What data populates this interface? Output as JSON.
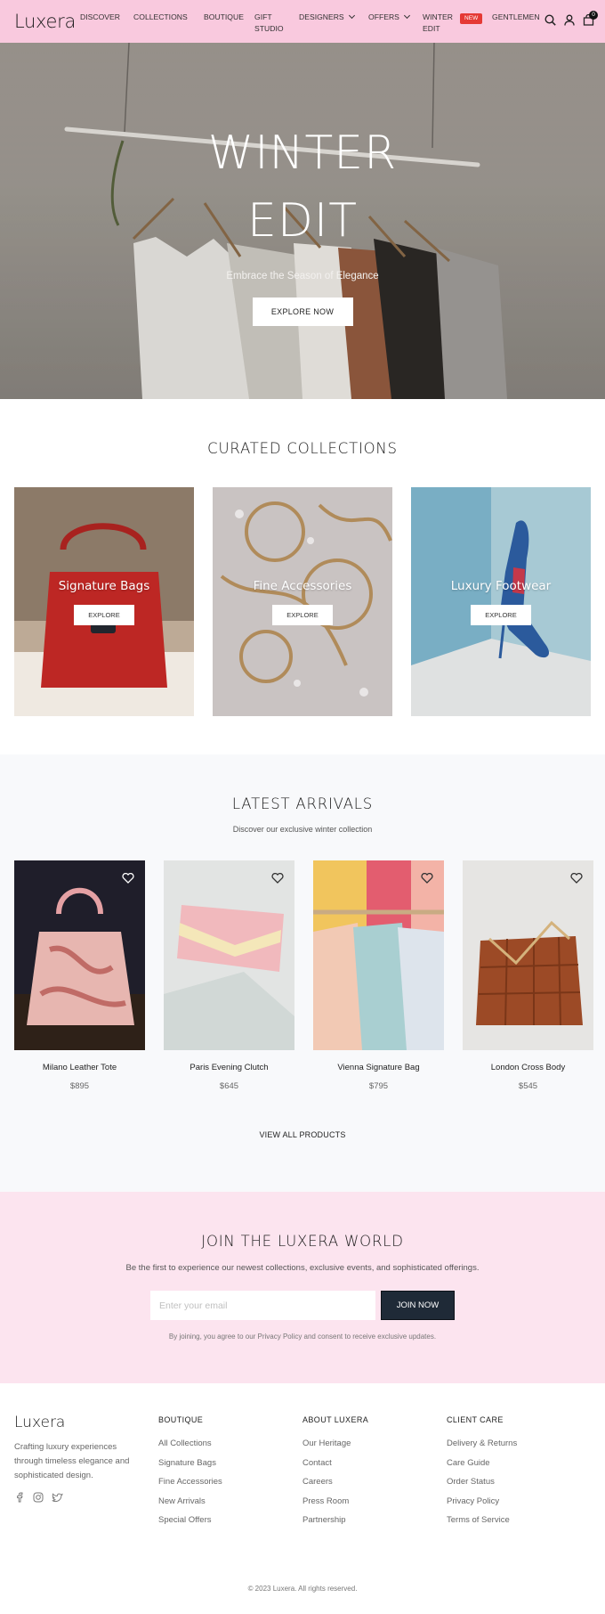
{
  "brand": "Luxera",
  "nav": {
    "items": [
      {
        "label": "DISCOVER",
        "left": 0
      },
      {
        "label": "COLLECTIONS"
      },
      {
        "label": "BOUTIQUE"
      },
      {
        "label": "GIFT STUDIO"
      },
      {
        "label": "DESIGNERS",
        "dropdown": true
      },
      {
        "label": "OFFERS",
        "dropdown": true
      },
      {
        "label": "WINTER EDIT",
        "badge": "New"
      },
      {
        "label": "GENTLEMEN"
      }
    ],
    "cart_count": "0"
  },
  "hero": {
    "title": "WINTER EDIT",
    "subtitle": "Embrace the Season of Elegance",
    "cta": "EXPLORE NOW"
  },
  "curated": {
    "title": "CURATED COLLECTIONS",
    "cards": [
      {
        "label": "Signature Bags",
        "cta": "EXPLORE"
      },
      {
        "label": "Fine Accessories",
        "cta": "EXPLORE"
      },
      {
        "label": "Luxury Footwear",
        "cta": "EXPLORE"
      }
    ]
  },
  "latest": {
    "title": "LATEST ARRIVALS",
    "subtitle": "Discover our exclusive winter collection",
    "products": [
      {
        "name": "Milano Leather Tote",
        "price": "$895"
      },
      {
        "name": "Paris Evening Clutch",
        "price": "$645"
      },
      {
        "name": "Vienna Signature Bag",
        "price": "$795"
      },
      {
        "name": "London Cross Body",
        "price": "$545"
      }
    ],
    "view_all": "VIEW ALL PRODUCTS"
  },
  "join": {
    "title": "JOIN THE LUXERA WORLD",
    "text": "Be the first to experience our newest collections, exclusive events, and sophisticated offerings.",
    "placeholder": "Enter your email",
    "button": "JOIN NOW",
    "note": "By joining, you agree to our Privacy Policy and consent to receive exclusive updates."
  },
  "footer": {
    "logo": "Luxera",
    "tagline": "Crafting luxury experiences through timeless elegance and sophisticated design.",
    "socials": [
      "facebook-icon",
      "instagram-icon",
      "twitter-icon"
    ],
    "columns": [
      {
        "title": "BOUTIQUE",
        "links": [
          "All Collections",
          "Signature Bags",
          "Fine Accessories",
          "New Arrivals",
          "Special Offers"
        ]
      },
      {
        "title": "ABOUT LUXERA",
        "links": [
          "Our Heritage",
          "Contact",
          "Careers",
          "Press Room",
          "Partnership"
        ]
      },
      {
        "title": "CLIENT CARE",
        "links": [
          "Delivery & Returns",
          "Care Guide",
          "Order Status",
          "Privacy Policy",
          "Terms of Service"
        ]
      }
    ],
    "copyright": "© 2023 Luxera. All rights reserved."
  },
  "colors": {
    "nav_bg": "#f9c9de",
    "join_bg": "#fce4ef",
    "badge": "#e53935",
    "button_dark": "#1f2a37"
  }
}
